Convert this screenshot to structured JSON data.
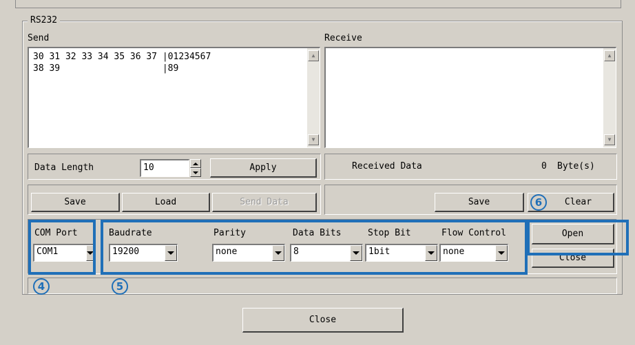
{
  "group": {
    "title": "RS232"
  },
  "send": {
    "label": "Send",
    "lines": [
      "30 31 32 33 34 35 36 37 |01234567",
      "38 39                   |89"
    ]
  },
  "receive": {
    "label": "Receive",
    "content": ""
  },
  "data_length": {
    "label": "Data Length",
    "value": "10",
    "apply_label": "Apply"
  },
  "received": {
    "label": "Received Data",
    "count": "0",
    "unit": "Byte(s)"
  },
  "send_actions": {
    "save": "Save",
    "load": "Load",
    "send_data": "Send Data"
  },
  "receive_actions": {
    "save": "Save",
    "clear": "Clear"
  },
  "com_port": {
    "label": "COM Port",
    "value": "COM1"
  },
  "settings": {
    "baudrate": {
      "label": "Baudrate",
      "value": "19200"
    },
    "parity": {
      "label": "Parity",
      "value": "none"
    },
    "data_bits": {
      "label": "Data Bits",
      "value": "8"
    },
    "stop_bit": {
      "label": "Stop Bit",
      "value": "1bit"
    },
    "flow_control": {
      "label": "Flow Control",
      "value": "none"
    }
  },
  "port_actions": {
    "open": "Open",
    "close": "Close"
  },
  "status": {
    "text": ""
  },
  "footer": {
    "close": "Close"
  },
  "callouts": {
    "c4": "4",
    "c5": "5",
    "c6": "6"
  },
  "colors": {
    "highlight": "#1f6fb8",
    "background": "#d4d0c8"
  }
}
